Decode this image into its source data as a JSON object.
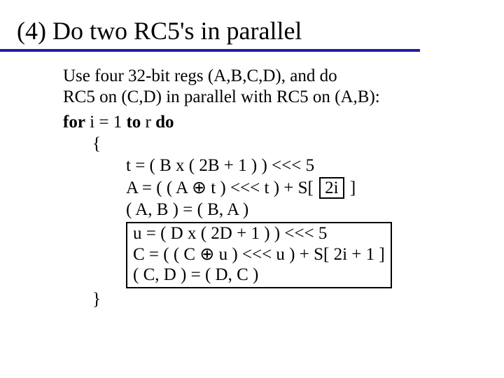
{
  "title": "(4) Do two RC5's in parallel",
  "intro1": "Use four 32-bit regs (A,B,C,D), and do",
  "intro2": "RC5 on (C,D) in parallel with RC5 on (A,B):",
  "code": {
    "for_kw": "for",
    "for_rest": " i = 1 ",
    "to_kw": "to",
    "to_rest": " r ",
    "do_kw": "do",
    "lbrace": "{",
    "t_line": "t = ( B x ( 2B + 1 ) )  <<<  5",
    "a_pre": "A = ( ( A ",
    "oplus": "⊕",
    "a_mid": " t )  <<<  t )  +  S[ ",
    "a_box": "2i",
    "a_post": " ]",
    "ab_swap": "( A, B ) = ( B, A )",
    "u_line": "u = ( D x ( 2D + 1 ) )  <<<  5",
    "c_pre": "C = ( ( C  ",
    "c_mid": " u )  <<<  u )  +  S[ 2i + 1 ]",
    "cd_swap": "( C, D ) = ( D, C )",
    "rbrace": "}"
  }
}
